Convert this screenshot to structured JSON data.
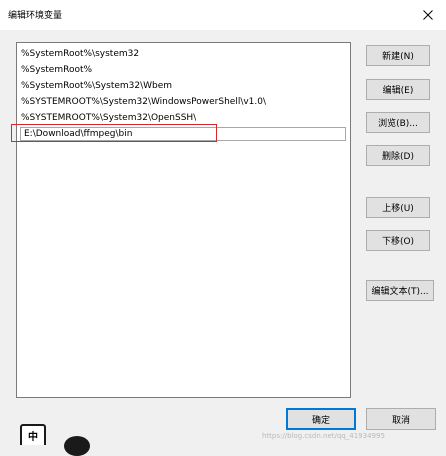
{
  "window": {
    "title": "编辑环境变量",
    "close_icon": "close-icon"
  },
  "path_list": {
    "items": [
      "%SystemRoot%\\system32",
      "%SystemRoot%",
      "%SystemRoot%\\System32\\Wbem",
      "%SYSTEMROOT%\\System32\\WindowsPowerShell\\v1.0\\",
      "%SYSTEMROOT%\\System32\\OpenSSH\\"
    ],
    "editing_value": "E:\\Download\\ffmpeg\\bin"
  },
  "buttons": {
    "new": "新建(N)",
    "edit": "编辑(E)",
    "browse": "浏览(B)...",
    "delete": "删除(D)",
    "move_up": "上移(U)",
    "move_down": "下移(O)",
    "edit_text": "编辑文本(T)...",
    "ok": "确定",
    "cancel": "取消"
  },
  "taskbar": {
    "ime_label": "中"
  },
  "watermark": "https://blog.csdn.net/qq_41934995"
}
